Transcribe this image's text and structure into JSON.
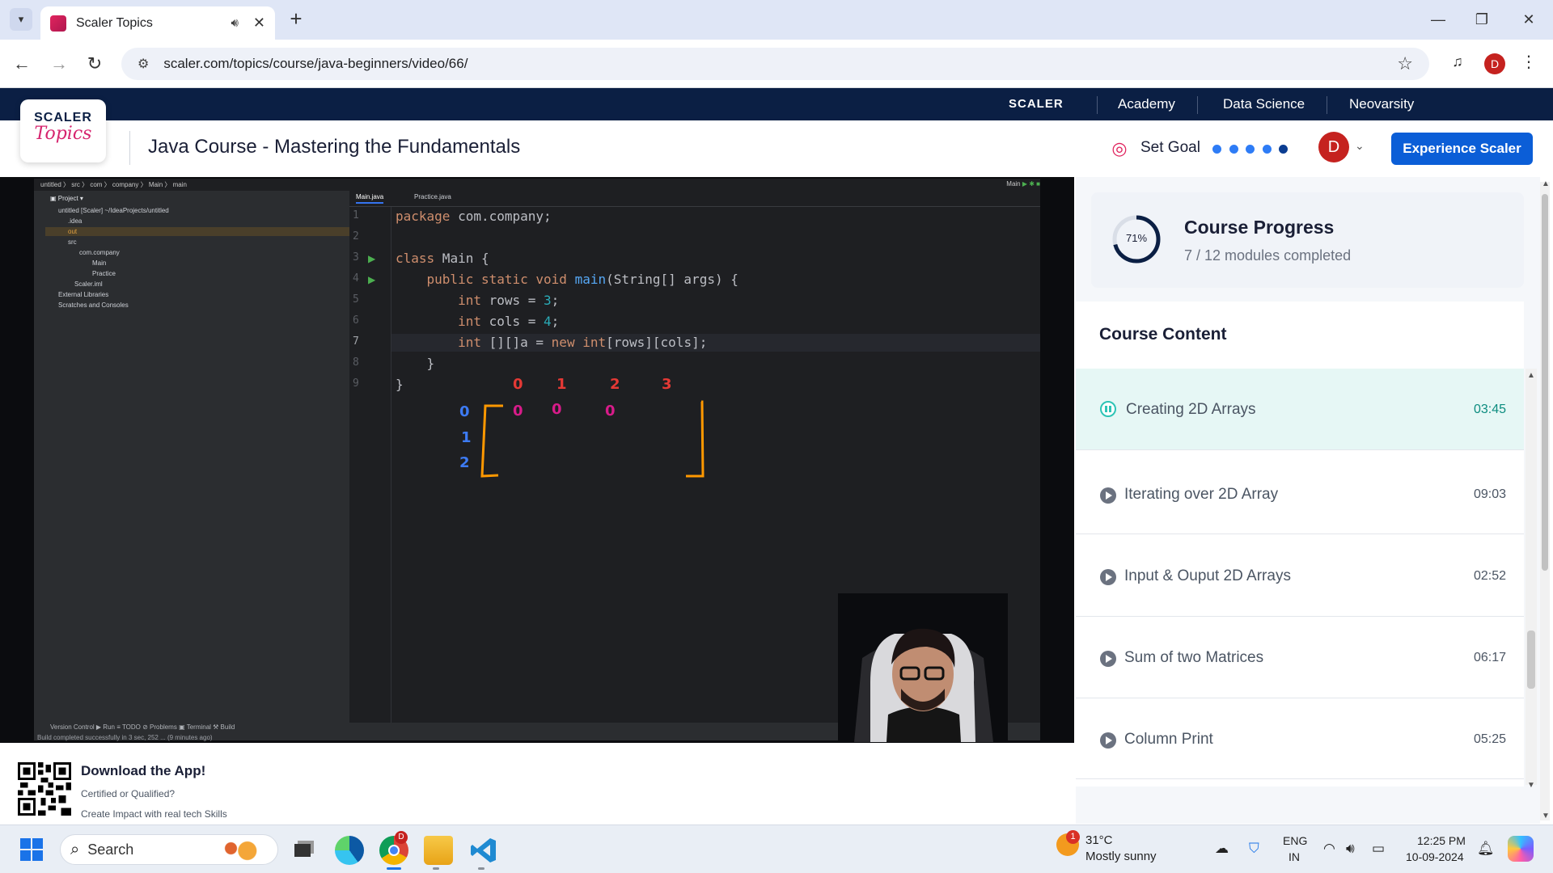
{
  "browser": {
    "tab_title": "Scaler Topics",
    "url": "scaler.com/topics/course/java-beginners/video/66/",
    "profile_initial": "D"
  },
  "site": {
    "logo_line1": "SCALER",
    "logo_line2": "Topics",
    "top_nav": [
      "SCALER",
      "Academy",
      "Data Science",
      "Neovarsity"
    ],
    "course_title": "Java Course - Mastering the Fundamentals",
    "set_goal": "Set Goal",
    "avatar_initial": "D",
    "cta": "Experience Scaler",
    "accent": "#0b5ed7",
    "brand_navy": "#0b1f44"
  },
  "ide": {
    "breadcrumb": "untitled 〉 src 〉 com 〉 company 〉 Main 〉 main",
    "project_label": "Project",
    "tree": [
      "untitled [Scaler]  ~/IdeaProjects/untitled",
      ".idea",
      "out",
      "src",
      "com.company",
      "Main",
      "Practice",
      "Scaler.iml",
      "External Libraries",
      "Scratches and Consoles"
    ],
    "tabs": [
      "Main.java",
      "Practice.java"
    ],
    "run_config": "Main",
    "line_numbers": [
      "1",
      "2",
      "3",
      "4",
      "5",
      "6",
      "7",
      "8",
      "9"
    ],
    "code": {
      "l1_kw": "package",
      "l1_rest": " com.company;",
      "l3_kw": "class",
      "l3_rest": " Main {",
      "l4_a": "    public static void ",
      "l4_fn": "main",
      "l4_b": "(String[] args) {",
      "l5_kw": "        int",
      "l5_b": " rows = ",
      "l5_num": "3",
      "l5_c": ";",
      "l6_kw": "        int",
      "l6_b": " cols = ",
      "l6_num": "4",
      "l6_c": ";",
      "l7_kw": "        int",
      "l7_b": " [][]a = ",
      "l7_kw2": "new",
      "l7_kw3": " int",
      "l7_c": "[rows][cols];",
      "l8": "    }",
      "l9": "}"
    },
    "annotation": {
      "col_index": [
        "0",
        "1",
        "2",
        "3"
      ],
      "row_index": [
        "0",
        "1",
        "2"
      ],
      "values": [
        "0",
        "0",
        "0"
      ]
    },
    "bottom_tools": "Version Control   ▶ Run   ≡ TODO   ⊘ Problems   ▣ Terminal   ⚒ Build",
    "status": "Build completed successfully in 3 sec, 252 ... (9 minutes ago)"
  },
  "progress": {
    "percent_label": "71%",
    "percent": 71,
    "title": "Course Progress",
    "subtitle": "7 / 12 modules completed"
  },
  "content": {
    "header": "Course Content",
    "lessons": [
      {
        "title": "Creating 2D Arrays",
        "time": "03:45",
        "active": true
      },
      {
        "title": "Iterating over 2D Array",
        "time": "09:03",
        "active": false
      },
      {
        "title": "Input & Ouput 2D Arrays",
        "time": "02:52",
        "active": false
      },
      {
        "title": "Sum of two Matrices",
        "time": "06:17",
        "active": false
      },
      {
        "title": "Column Print",
        "time": "05:25",
        "active": false
      }
    ]
  },
  "app_banner": {
    "title": "Download the App!",
    "line1": "Certified or Qualified?",
    "line2": "Create Impact with real tech Skills"
  },
  "taskbar": {
    "search": "Search",
    "chrome_badge": "D",
    "weather_badge": "1",
    "temp": "31°C",
    "condition": "Mostly sunny",
    "lang1": "ENG",
    "lang2": "IN",
    "time": "12:25 PM",
    "date": "10-09-2024"
  }
}
